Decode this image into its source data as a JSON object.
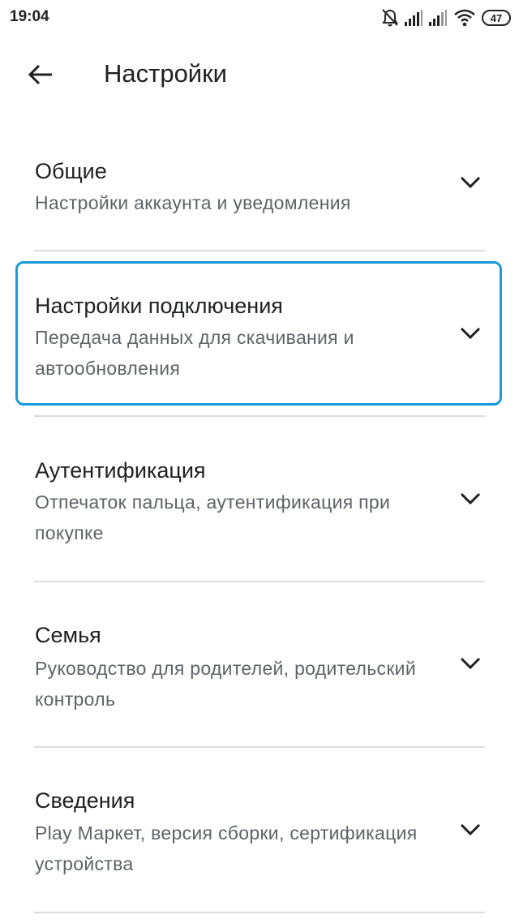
{
  "status_bar": {
    "time": "19:04",
    "battery": "47",
    "icons": [
      "bell-off-icon",
      "signal-icon",
      "signal-icon",
      "wifi-icon",
      "battery-icon"
    ]
  },
  "header": {
    "title": "Настройки",
    "back_icon": "arrow-back-icon"
  },
  "sections": [
    {
      "title": "Общие",
      "subtitle": "Настройки аккаунта и уведомления"
    },
    {
      "title": "Настройки подключения",
      "subtitle": "Передача данных для скачивания и автообновления"
    },
    {
      "title": "Аутентификация",
      "subtitle": "Отпечаток пальца, аутентификация при покупке"
    },
    {
      "title": "Семья",
      "subtitle": "Руководство для родителей, родительский контроль"
    },
    {
      "title": "Сведения",
      "subtitle": "Play Маркет, версия сборки, сертификация устройства"
    }
  ],
  "colors": {
    "focus": "#1a9ad6",
    "divider": "#dadce0",
    "text_primary": "#202124",
    "text_secondary": "#5f6368"
  }
}
